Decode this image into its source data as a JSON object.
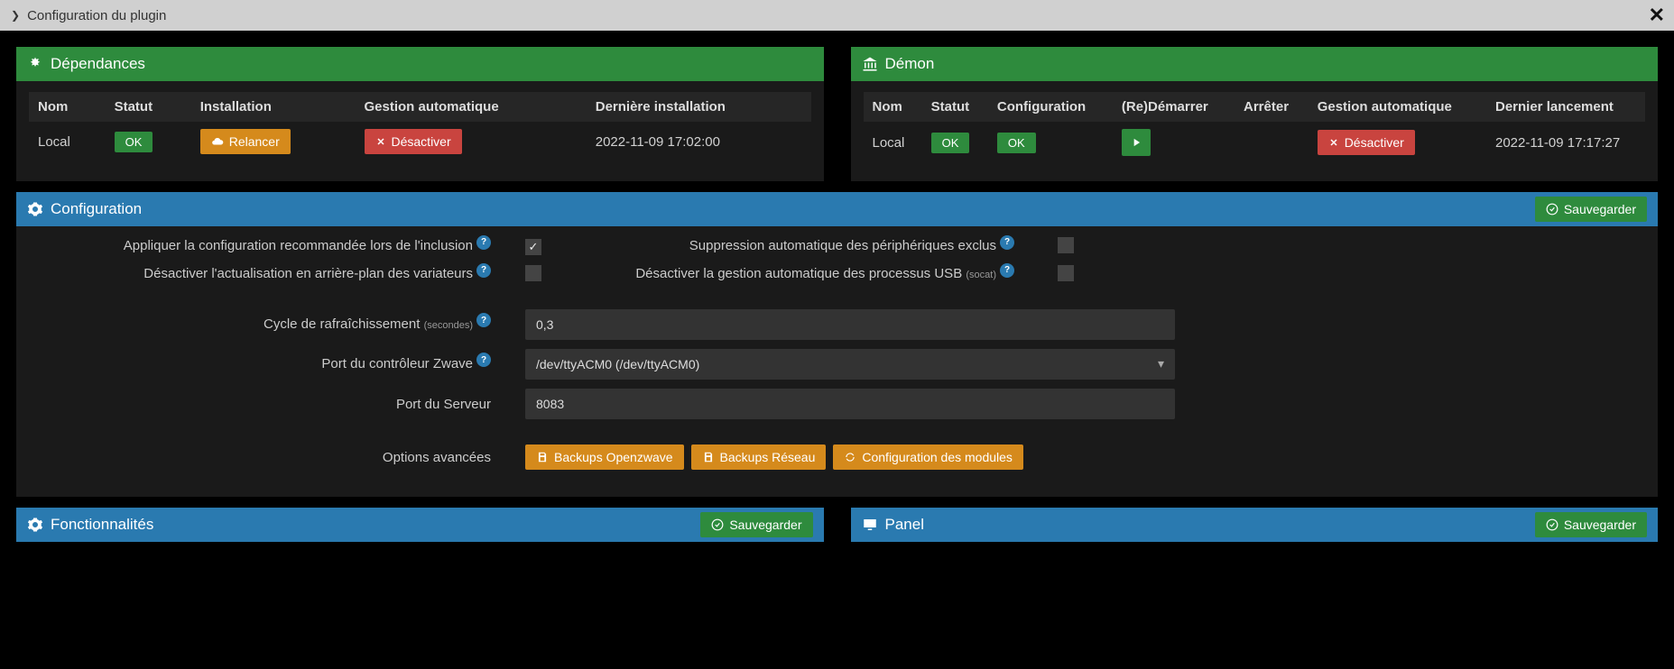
{
  "topbar": {
    "title": "Configuration du plugin"
  },
  "dependencies": {
    "title": "Dépendances",
    "headers": {
      "name": "Nom",
      "status": "Statut",
      "install": "Installation",
      "auto": "Gestion automatique",
      "last": "Dernière installation"
    },
    "row": {
      "name": "Local",
      "status": "OK",
      "relaunch": "Relancer",
      "disable": "Désactiver",
      "last": "2022-11-09 17:02:00"
    }
  },
  "daemon": {
    "title": "Démon",
    "headers": {
      "name": "Nom",
      "status": "Statut",
      "config": "Configuration",
      "restart": "(Re)Démarrer",
      "stop": "Arrêter",
      "auto": "Gestion automatique",
      "last": "Dernier lancement"
    },
    "row": {
      "name": "Local",
      "status": "OK",
      "config": "OK",
      "disable": "Désactiver",
      "last": "2022-11-09 17:17:27"
    }
  },
  "configuration": {
    "title": "Configuration",
    "save": "Sauvegarder",
    "labels": {
      "apply_reco": "Appliquer la configuration recommandée lors de l'inclusion",
      "disable_bg": "Désactiver l'actualisation en arrière-plan des variateurs",
      "suppress_excl": "Suppression automatique des périphériques exclus",
      "disable_usb": "Désactiver la gestion automatique des processus USB ",
      "disable_usb_small": "(socat)",
      "refresh": "Cycle de rafraîchissement ",
      "refresh_small": "(secondes)",
      "zwave_port": "Port du contrôleur Zwave",
      "server_port": "Port du Serveur",
      "advanced": "Options avancées"
    },
    "values": {
      "apply_reco": true,
      "disable_bg": false,
      "suppress_excl": false,
      "disable_usb": false,
      "refresh": "0,3",
      "zwave_port": "/dev/ttyACM0 (/dev/ttyACM0)",
      "server_port": "8083"
    },
    "buttons": {
      "backups_oz": "Backups Openzwave",
      "backups_net": "Backups Réseau",
      "config_mod": "Configuration des modules"
    }
  },
  "features": {
    "title": "Fonctionnalités",
    "save": "Sauvegarder"
  },
  "panel": {
    "title": "Panel",
    "save": "Sauvegarder"
  }
}
